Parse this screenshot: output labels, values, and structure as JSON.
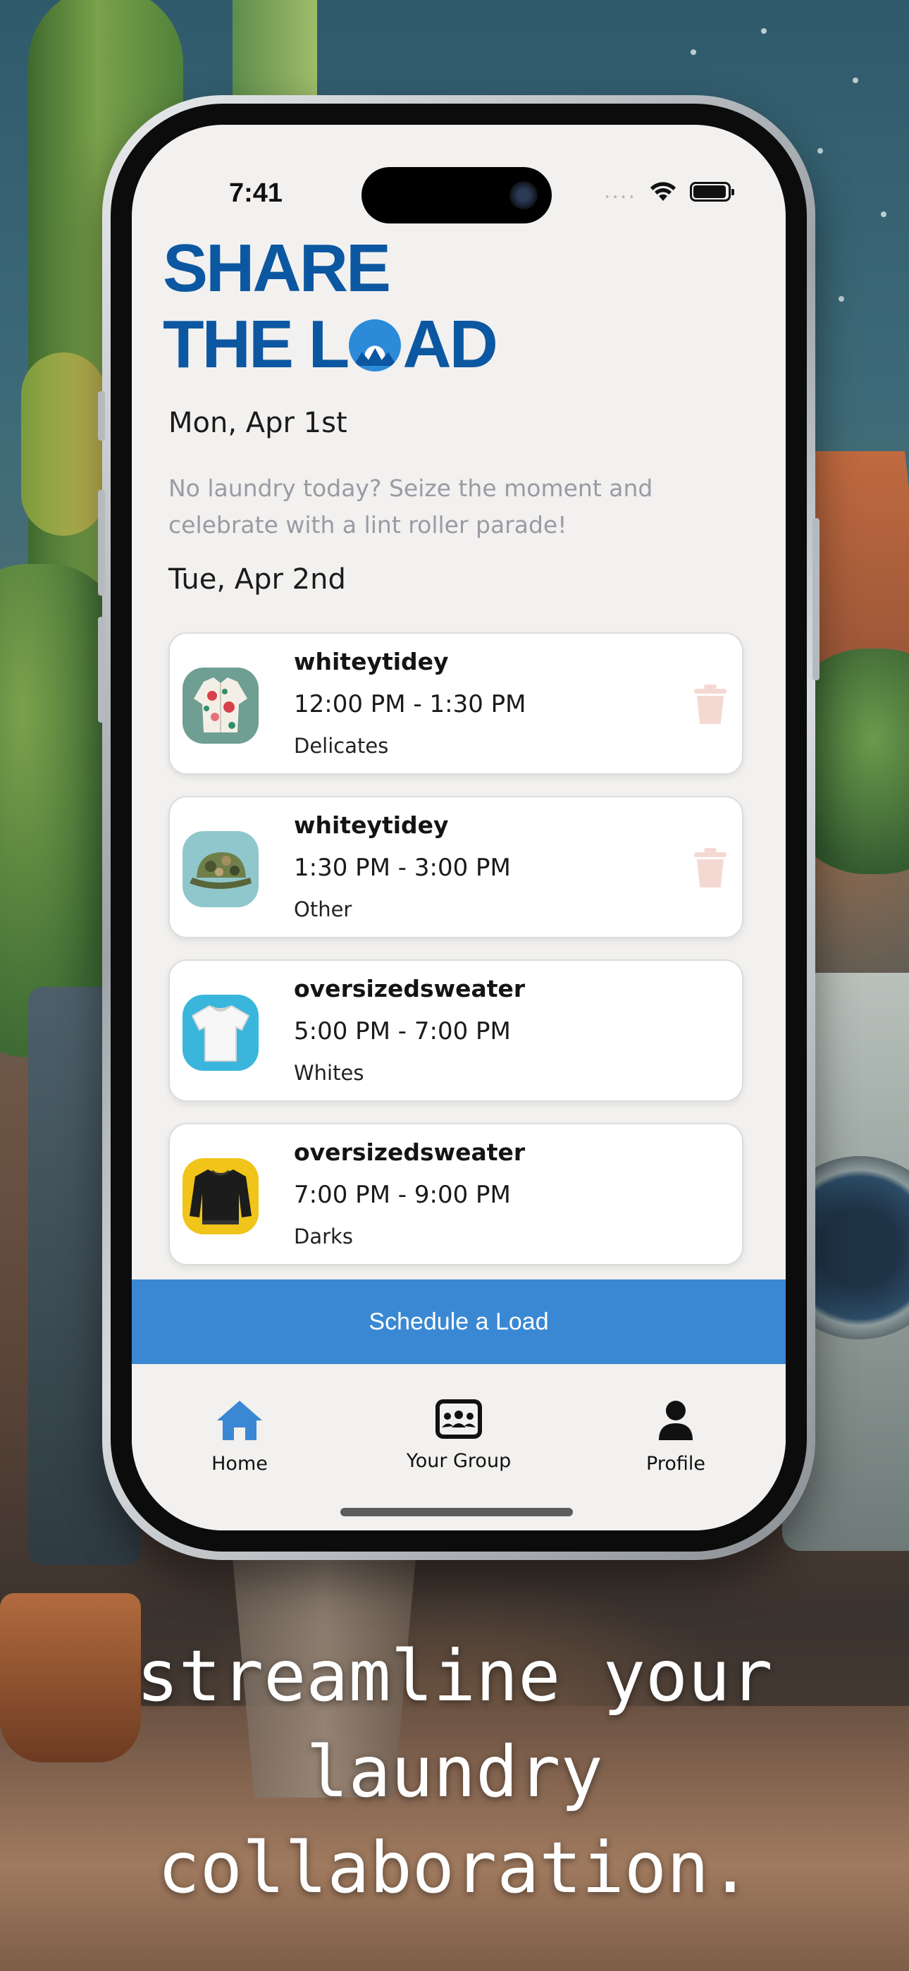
{
  "status_bar": {
    "time": "7:41",
    "signal": "....",
    "wifi_icon": "wifi-icon",
    "battery_icon": "battery-icon"
  },
  "logo": {
    "line1": "SHARE",
    "line2_prefix": "THE L",
    "line2_suffix": "AD"
  },
  "days": [
    {
      "label": "Mon, Apr 1st",
      "empty_message": "No laundry today? Seize the moment and celebrate with a lint roller parade!",
      "loads": []
    },
    {
      "label": "Tue, Apr 2nd",
      "loads": [
        {
          "user": "whiteytidey",
          "time": "12:00 PM - 1:30 PM",
          "category": "Delicates",
          "icon": "floral-shirt-icon",
          "deletable": true
        },
        {
          "user": "whiteytidey",
          "time": "1:30 PM - 3:00 PM",
          "category": "Other",
          "icon": "camo-cap-icon",
          "deletable": true
        },
        {
          "user": "oversizedsweater",
          "time": "5:00 PM - 7:00 PM",
          "category": "Whites",
          "icon": "white-tshirt-icon",
          "deletable": false
        },
        {
          "user": "oversizedsweater",
          "time": "7:00 PM - 9:00 PM",
          "category": "Darks",
          "icon": "black-sweater-icon",
          "deletable": false
        }
      ]
    }
  ],
  "schedule_button": "Schedule a Load",
  "tabs": [
    {
      "label": "Home",
      "icon": "home-icon",
      "active": true
    },
    {
      "label": "Your Group",
      "icon": "group-icon",
      "active": false
    },
    {
      "label": "Profile",
      "icon": "profile-icon",
      "active": false
    }
  ],
  "colors": {
    "brand_blue": "#0c57a1",
    "button_blue": "#3a88d3",
    "trash_pink": "#f4d9d3"
  },
  "tagline": [
    "streamline your",
    "laundry",
    "collaboration."
  ]
}
